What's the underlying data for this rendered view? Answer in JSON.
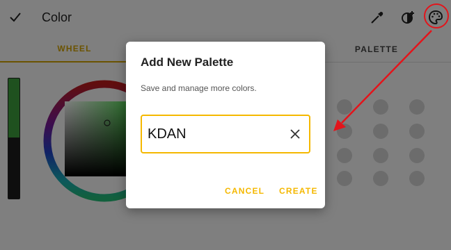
{
  "topbar": {
    "title": "Color",
    "icons": [
      "check-icon",
      "eyedropper-icon",
      "add-color-icon",
      "palette-icon"
    ]
  },
  "tabs": [
    {
      "label": "WHEEL",
      "active": true
    },
    {
      "label": "PALETTE",
      "active": false
    }
  ],
  "brightness_level": 0.49,
  "dialog": {
    "title": "Add New Palette",
    "subtitle": "Save and manage more colors.",
    "name_value": "KDAN",
    "cancel_label": "CANCEL",
    "create_label": "CREATE"
  },
  "colors": {
    "accent": "#f5b800",
    "tab_accent": "#d7a600",
    "annotation": "#e3141b",
    "selected_color": "#3fa33f"
  }
}
